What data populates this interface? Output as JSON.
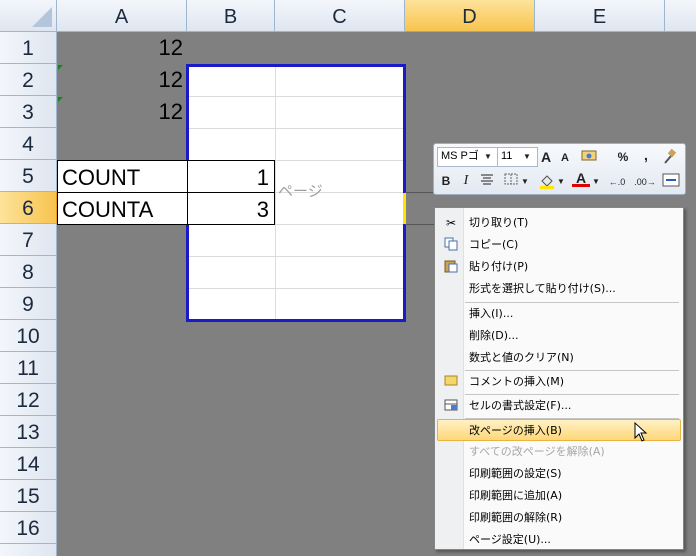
{
  "columns": [
    "A",
    "B",
    "C",
    "D",
    "E"
  ],
  "rows": [
    "1",
    "2",
    "3",
    "4",
    "5",
    "6",
    "7",
    "8",
    "9",
    "10",
    "11",
    "12",
    "13",
    "14",
    "15",
    "16"
  ],
  "cells": {
    "a1": "12",
    "a2": "12",
    "a3": "12",
    "a5": "COUNT",
    "a6": "COUNTA",
    "b5": "1",
    "b6": "3"
  },
  "page_break_label": "ページ",
  "mini_toolbar": {
    "font_name": "MS Pゴ",
    "font_size": "11",
    "grow_font": "A",
    "shrink_font": "A",
    "percent": "%",
    "comma": ",",
    "bold": "B",
    "italic": "I",
    "font_color_letter": "A",
    "inc_decimal": "←.0",
    "dec_decimal": ".00→"
  },
  "context_menu": {
    "items": [
      {
        "label": "切り取り(T)",
        "icon": "scissors-icon"
      },
      {
        "label": "コピー(C)",
        "icon": "copy-icon"
      },
      {
        "label": "貼り付け(P)",
        "icon": "paste-icon"
      },
      {
        "label": "形式を選択して貼り付け(S)..."
      },
      {
        "label": "挿入(I)..."
      },
      {
        "label": "削除(D)..."
      },
      {
        "label": "数式と値のクリア(N)"
      },
      {
        "label": "コメントの挿入(M)",
        "icon": "comment-icon"
      },
      {
        "label": "セルの書式設定(F)...",
        "icon": "format-cells-icon"
      },
      {
        "label": "改ページの挿入(B)",
        "highlighted": true
      },
      {
        "label": "すべての改ページを解除(A)",
        "disabled": true
      },
      {
        "label": "印刷範囲の設定(S)"
      },
      {
        "label": "印刷範囲に追加(A)"
      },
      {
        "label": "印刷範囲の解除(R)"
      },
      {
        "label": "ページ設定(U)..."
      }
    ]
  },
  "colors": {
    "print_area_border": "#1a1ac8",
    "selection_header": "#f8c34e",
    "workspace": "#808080",
    "menu_highlight": "#ffd77a"
  }
}
